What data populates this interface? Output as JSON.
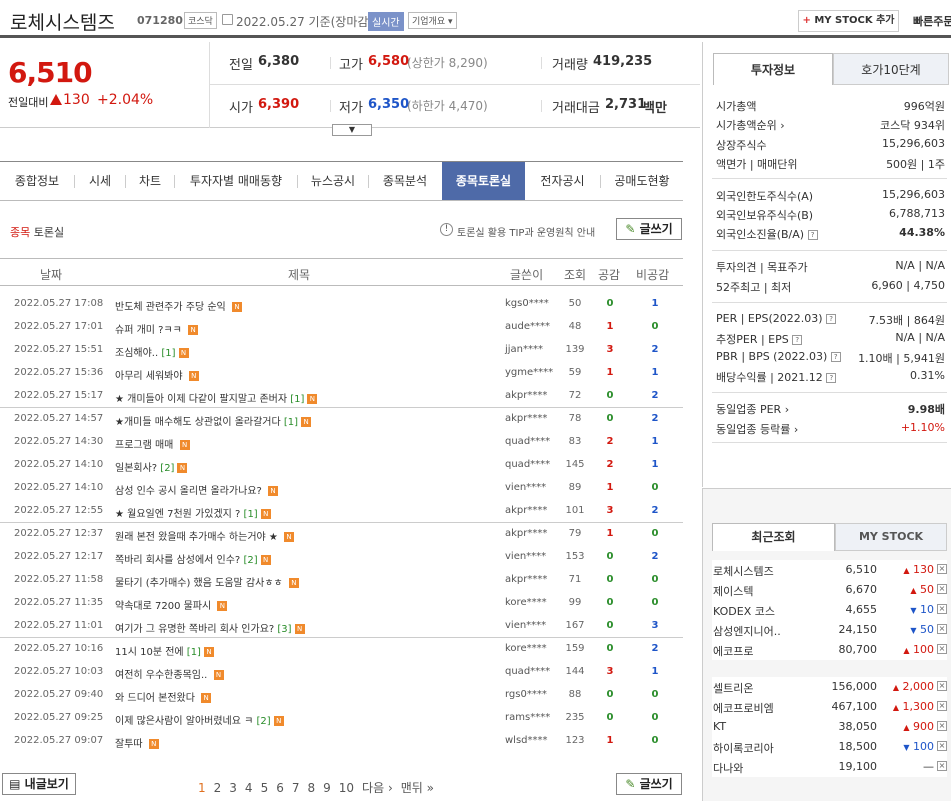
{
  "header": {
    "company": "로체시스템즈",
    "code": "071280",
    "market": "코스닥",
    "date": "2022.05.27",
    "date_note": "기준(장마감)",
    "realtime": "실시간",
    "corp_info": "기업개요 ▾",
    "mystock_add": "MY STOCK 추가",
    "mystock_plus": "+",
    "quick_order": "빠른주문"
  },
  "price": {
    "current": "6,510",
    "prev_label": "전일대비",
    "change": "130",
    "change_pct": "+2.04%",
    "prev_close_label": "전일",
    "prev_close": "6,380",
    "high_label": "고가",
    "high": "6,580",
    "upper_limit": "(상한가 8,290)",
    "volume_label": "거래량",
    "volume": "419,235",
    "open_label": "시가",
    "open": "6,390",
    "low_label": "저가",
    "low": "6,350",
    "lower_limit": "(하한가 4,470)",
    "amount_label": "거래대금",
    "amount": "2,731",
    "amount_unit": "백만"
  },
  "tabs": [
    "종합정보",
    "시세",
    "차트",
    "투자자별 매매동향",
    "뉴스공시",
    "종목분석",
    "종목토론실",
    "전자공시",
    "공매도현황"
  ],
  "board": {
    "title_a": "종목",
    "title_b": "토론실",
    "tip_icon": "!",
    "tip": "토론실 활용 TIP과 운영원칙 안내",
    "write": "글쓰기",
    "my_posts": "내글보기",
    "cols": [
      "날짜",
      "제목",
      "글쓴이",
      "조회",
      "공감",
      "비공감"
    ],
    "rows": [
      {
        "date": "2022.05.27 17:08",
        "title": "반도체 관련주가 주당 순익",
        "cnt": "",
        "user": "kgs0****",
        "views": "50",
        "good": "0",
        "bad": "1"
      },
      {
        "date": "2022.05.27 17:01",
        "title": "슈퍼 개미 ?ㅋㅋ",
        "cnt": "",
        "user": "aude****",
        "views": "48",
        "good": "1",
        "bad": "0"
      },
      {
        "date": "2022.05.27 15:51",
        "title": "조심해야..",
        "cnt": "[1]",
        "user": "jjan****",
        "views": "139",
        "good": "3",
        "bad": "2"
      },
      {
        "date": "2022.05.27 15:36",
        "title": "아무리 세워봐야",
        "cnt": "",
        "user": "ygme****",
        "views": "59",
        "good": "1",
        "bad": "1"
      },
      {
        "date": "2022.05.27 15:17",
        "title": "★ 개미들아 이제 다같이 팔지말고 존버자",
        "cnt": "[1]",
        "user": "akpr****",
        "views": "72",
        "good": "0",
        "bad": "2"
      },
      {
        "date": "2022.05.27 14:57",
        "title": "★개미들 매수해도 상관없이 올라갈거다",
        "cnt": "[1]",
        "user": "akpr****",
        "views": "78",
        "good": "0",
        "bad": "2"
      },
      {
        "date": "2022.05.27 14:30",
        "title": "프로그램 매매",
        "cnt": "",
        "user": "quad****",
        "views": "83",
        "good": "2",
        "bad": "1"
      },
      {
        "date": "2022.05.27 14:10",
        "title": "일본회사?",
        "cnt": "[2]",
        "user": "quad****",
        "views": "145",
        "good": "2",
        "bad": "1"
      },
      {
        "date": "2022.05.27 14:10",
        "title": "삼성 인수 공시 올리면 올라가나요?",
        "cnt": "",
        "user": "vien****",
        "views": "89",
        "good": "1",
        "bad": "0"
      },
      {
        "date": "2022.05.27 12:55",
        "title": "★ 월요일엔 7천원 가있겠지 ?",
        "cnt": "[1]",
        "user": "akpr****",
        "views": "101",
        "good": "3",
        "bad": "2"
      },
      {
        "date": "2022.05.27 12:37",
        "title": "원래 본전 왔을때 추가매수 하는거야 ★",
        "cnt": "",
        "user": "akpr****",
        "views": "79",
        "good": "1",
        "bad": "0"
      },
      {
        "date": "2022.05.27 12:17",
        "title": "쪽바리 회사를 삼성에서 인수?",
        "cnt": "[2]",
        "user": "vien****",
        "views": "153",
        "good": "0",
        "bad": "2"
      },
      {
        "date": "2022.05.27 11:58",
        "title": "물타기 (추가매수) 했음 도움말 감사ㅎㅎ",
        "cnt": "",
        "user": "akpr****",
        "views": "71",
        "good": "0",
        "bad": "0"
      },
      {
        "date": "2022.05.27 11:35",
        "title": "약속대로 7200 물파시",
        "cnt": "",
        "user": "kore****",
        "views": "99",
        "good": "0",
        "bad": "0"
      },
      {
        "date": "2022.05.27 11:01",
        "title": "여기가 그 유명한 쪽바리 회사 인가요?",
        "cnt": "[3]",
        "user": "vien****",
        "views": "167",
        "good": "0",
        "bad": "3"
      },
      {
        "date": "2022.05.27 10:16",
        "title": "11시 10분 전에",
        "cnt": "[1]",
        "user": "kore****",
        "views": "159",
        "good": "0",
        "bad": "2"
      },
      {
        "date": "2022.05.27 10:03",
        "title": "여전히 우수한종목임..",
        "cnt": "",
        "user": "quad****",
        "views": "144",
        "good": "3",
        "bad": "1"
      },
      {
        "date": "2022.05.27 09:40",
        "title": "와 드디어 본전왔다",
        "cnt": "",
        "user": "rgs0****",
        "views": "88",
        "good": "0",
        "bad": "0"
      },
      {
        "date": "2022.05.27 09:25",
        "title": "이제 많은사람이 알아버렸네요 ㅋ",
        "cnt": "[2]",
        "user": "rams****",
        "views": "235",
        "good": "0",
        "bad": "0"
      },
      {
        "date": "2022.05.27 09:07",
        "title": "잘투따",
        "cnt": "",
        "user": "wlsd****",
        "views": "123",
        "good": "1",
        "bad": "0"
      }
    ],
    "new_badge": "N",
    "pages": [
      "1",
      "2",
      "3",
      "4",
      "5",
      "6",
      "7",
      "8",
      "9",
      "10"
    ],
    "next": "다음 ›",
    "last": "맨뒤 »"
  },
  "invest": {
    "tabs": [
      "투자정보",
      "호가10단계"
    ],
    "rows": [
      {
        "l": "시가총액",
        "v": "996억원"
      },
      {
        "l": "시가총액순위 ›",
        "v": "코스닥 934위"
      },
      {
        "l": "상장주식수",
        "v": "15,296,603"
      },
      {
        "l": "액면가 | 매매단위",
        "v": "500원 | 1주"
      },
      {
        "l": "외국인한도주식수(A)",
        "v": "15,296,603"
      },
      {
        "l": "외국인보유주식수(B)",
        "v": "6,788,713"
      },
      {
        "l": "외국인소진율(B/A)",
        "v": "44.38%",
        "q": true
      },
      {
        "l": "투자의견 | 목표주가",
        "v": "N/A | N/A"
      },
      {
        "l": "52주최고 | 최저",
        "v": "6,960 | 4,750"
      },
      {
        "l": "PER | EPS(2022.03)",
        "v": "7.53배 | 864원",
        "q": true
      },
      {
        "l": "추정PER | EPS",
        "v": "N/A | N/A",
        "q": true
      },
      {
        "l": "PBR | BPS (2022.03)",
        "v": "1.10배 | 5,941원",
        "q": true
      },
      {
        "l": "배당수익률 | 2021.12",
        "v": "0.31%",
        "q": true
      },
      {
        "l": "동일업종 PER ›",
        "v": "9.98배"
      },
      {
        "l": "동일업종 등락률 ›",
        "v": "+1.10%"
      }
    ]
  },
  "recent": {
    "tabs": [
      "최근조회",
      "MY STOCK"
    ],
    "close": "×",
    "items": [
      {
        "name": "로체시스템즈",
        "price": "6,510",
        "dir": "up",
        "chg": "130"
      },
      {
        "name": "제이스텍",
        "price": "6,670",
        "dir": "up",
        "chg": "50"
      },
      {
        "name": "KODEX 코스",
        "price": "4,655",
        "dir": "down",
        "chg": "10"
      },
      {
        "name": "삼성엔지니어..",
        "price": "24,150",
        "dir": "down",
        "chg": "50"
      },
      {
        "name": "에코프로",
        "price": "80,700",
        "dir": "up",
        "chg": "100"
      },
      {
        "name": "셀트리온",
        "price": "156,000",
        "dir": "up",
        "chg": "2,000"
      },
      {
        "name": "에코프로비엠",
        "price": "467,100",
        "dir": "up",
        "chg": "1,300"
      },
      {
        "name": "KT",
        "price": "38,050",
        "dir": "up",
        "chg": "900"
      },
      {
        "name": "하이록코리아",
        "price": "18,500",
        "dir": "down",
        "chg": "100"
      },
      {
        "name": "다나와",
        "price": "19,100",
        "dir": "flat",
        "chg": "—"
      }
    ]
  }
}
